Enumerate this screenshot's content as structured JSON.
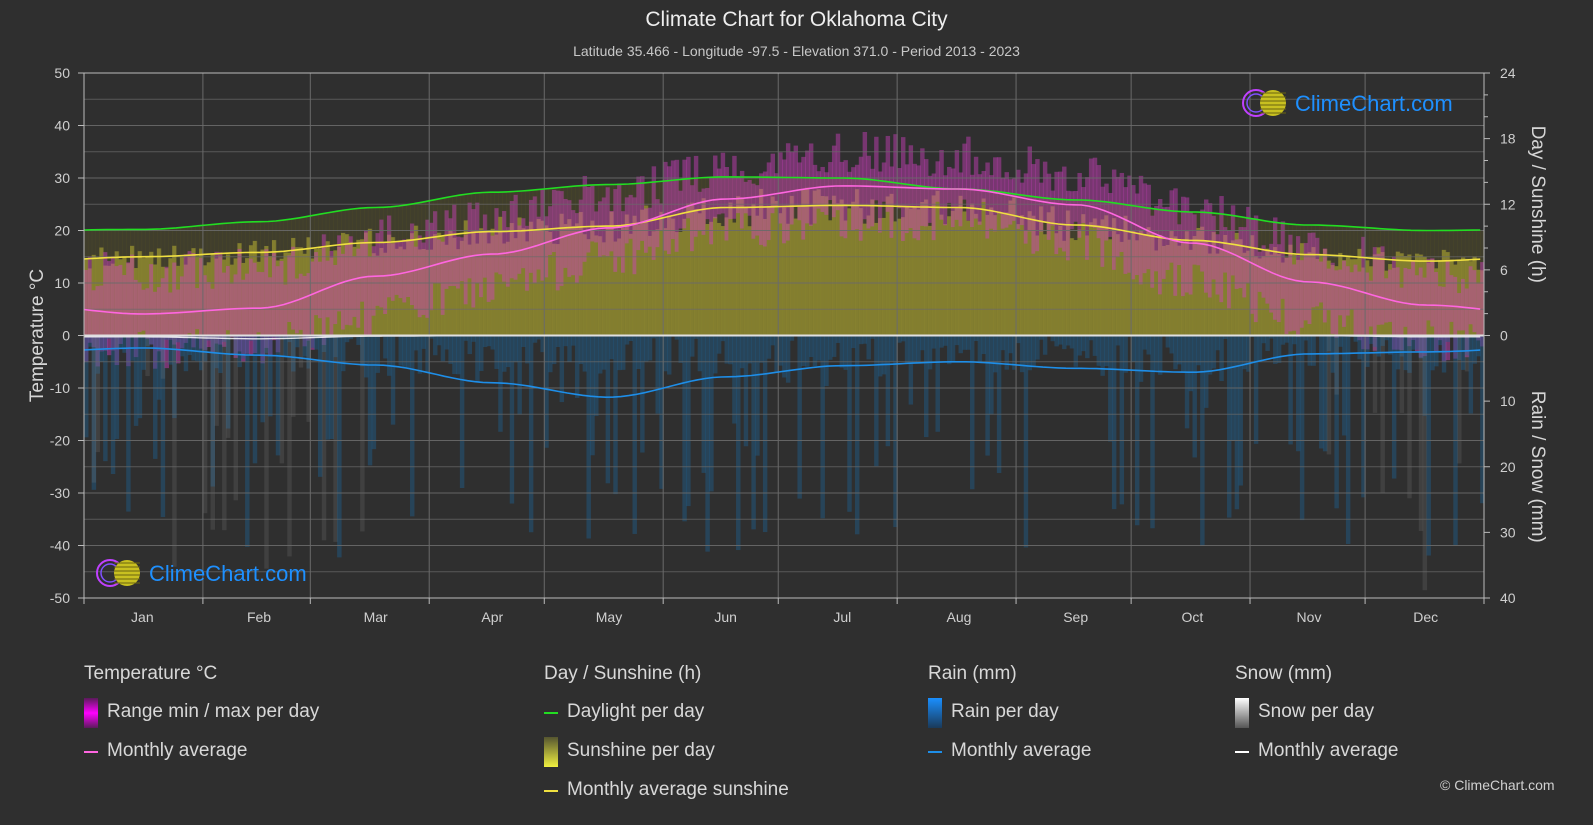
{
  "title": "Climate Chart for Oklahoma City",
  "subtitle": "Latitude 35.466 - Longitude -97.5 - Elevation 371.0 - Period 2013 - 2023",
  "watermark": "ClimeChart.com",
  "copyright": "© ClimeChart.com",
  "colors": {
    "background": "#2f2f2f",
    "temperature_avg": "#ff66e0",
    "temperature_range": "#e000e0",
    "daylight": "#22dd22",
    "sunshine_avg": "#f0e040",
    "sunshine_fill": "#8f8a30",
    "rain_avg": "#1e8ee8",
    "rain_bar": "#1f5f8f",
    "snow_avg": "#ffffff",
    "brand_blue": "#1e90ff"
  },
  "legend": {
    "temperature": {
      "header": "Temperature °C",
      "items": [
        "Range min / max per day",
        "Monthly average"
      ]
    },
    "sunshine": {
      "header": "Day / Sunshine (h)",
      "items": [
        "Daylight per day",
        "Sunshine per day",
        "Monthly average sunshine"
      ]
    },
    "rain": {
      "header": "Rain (mm)",
      "items": [
        "Rain per day",
        "Monthly average"
      ]
    },
    "snow": {
      "header": "Snow (mm)",
      "items": [
        "Snow per day",
        "Monthly average"
      ]
    }
  },
  "chart_data": {
    "type": "line",
    "title": "Climate Chart for Oklahoma City",
    "categories": [
      "Jan",
      "Feb",
      "Mar",
      "Apr",
      "May",
      "Jun",
      "Jul",
      "Aug",
      "Sep",
      "Oct",
      "Nov",
      "Dec"
    ],
    "left_axis": {
      "label": "Temperature °C",
      "range": [
        -50,
        50
      ],
      "ticks": [
        50,
        40,
        30,
        20,
        10,
        0,
        -10,
        -20,
        -30,
        -40,
        -50
      ]
    },
    "right_axis_top": {
      "label": "Day / Sunshine (h)",
      "range": [
        0,
        24
      ],
      "ticks": [
        24,
        18,
        12,
        6,
        0
      ]
    },
    "right_axis_bottom": {
      "label": "Rain / Snow (mm)",
      "range": [
        0,
        40
      ],
      "ticks": [
        0,
        10,
        20,
        30,
        40
      ]
    },
    "grid": true,
    "series": [
      {
        "name": "Temperature monthly average (°C)",
        "axis": "left",
        "values": [
          4.1,
          5.2,
          11.3,
          15.5,
          20.5,
          26.0,
          28.5,
          27.9,
          24.9,
          17.6,
          10.2,
          5.8
        ]
      },
      {
        "name": "Daylight per day (h)",
        "axis": "right_top",
        "values": [
          9.7,
          10.4,
          11.7,
          13.1,
          13.8,
          14.5,
          14.4,
          13.4,
          12.4,
          11.3,
          10.1,
          9.6
        ]
      },
      {
        "name": "Monthly average sunshine (h)",
        "axis": "right_top",
        "values": [
          7.2,
          7.6,
          8.5,
          9.5,
          10.0,
          11.7,
          11.9,
          11.7,
          10.1,
          8.7,
          7.4,
          6.8
        ]
      },
      {
        "name": "Rain monthly average (mm)",
        "axis": "right_bottom",
        "values": [
          1.9,
          3.0,
          4.5,
          7.2,
          9.4,
          6.3,
          4.6,
          4.0,
          5.0,
          5.6,
          2.8,
          2.5
        ]
      },
      {
        "name": "Snow monthly average (mm)",
        "axis": "right_bottom",
        "values": [
          0.2,
          0.5,
          0.1,
          0,
          0,
          0,
          0,
          0,
          0,
          0,
          0,
          0.2
        ]
      }
    ],
    "temperature_range_approx": {
      "max": [
        12,
        13,
        19,
        23,
        27,
        32,
        35,
        34,
        31,
        24,
        17,
        12
      ],
      "min": [
        -3,
        -2,
        4,
        9,
        15,
        20,
        22,
        22,
        18,
        10,
        3,
        -1
      ]
    }
  }
}
